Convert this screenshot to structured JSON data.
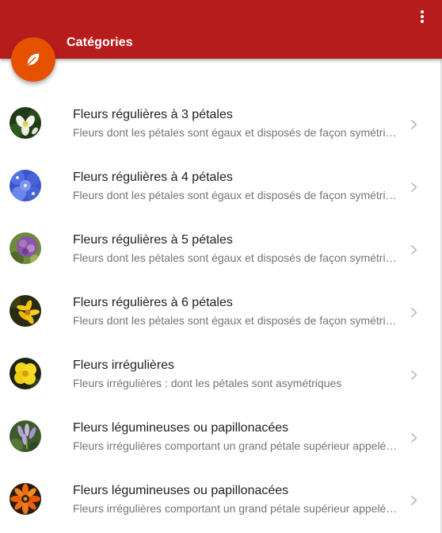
{
  "header": {
    "title": "Catégories",
    "color": "#b71c1c"
  },
  "fab": {
    "icon": "leaf-icon",
    "color": "#e65100"
  },
  "categories": [
    {
      "title": "Fleurs régulières à 3 pétales",
      "subtitle": "Fleurs dont les pétales sont égaux et disposés de façon symétrique",
      "image": "white-flower"
    },
    {
      "title": "Fleurs régulières à 4 pétales",
      "subtitle": "Fleurs dont les pétales sont égaux et disposés de façon symétrique",
      "image": "blue-flower"
    },
    {
      "title": "Fleurs régulières à 5 pétales",
      "subtitle": "Fleurs dont les pétales sont égaux et disposés de façon symétrique",
      "image": "purple-flower"
    },
    {
      "title": "Fleurs régulières à 6 pétales",
      "subtitle": "Fleurs dont les pétales sont égaux et disposés de façon symétrique",
      "image": "yellow-star-flower"
    },
    {
      "title": "Fleurs irrégulières",
      "subtitle": "Fleurs irrégulières : dont les pétales sont asymétriques",
      "image": "yellow-flower"
    },
    {
      "title": "Fleurs légumineuses ou papillonacées",
      "subtitle": "Fleurs irrégulières comportant un grand pétale supérieur appelé étendard",
      "image": "lilac-flower"
    },
    {
      "title": "Fleurs légumineuses ou papillonacées",
      "subtitle": "Fleurs irrégulières comportant un grand pétale supérieur appelé étendard",
      "image": "orange-flower"
    }
  ]
}
